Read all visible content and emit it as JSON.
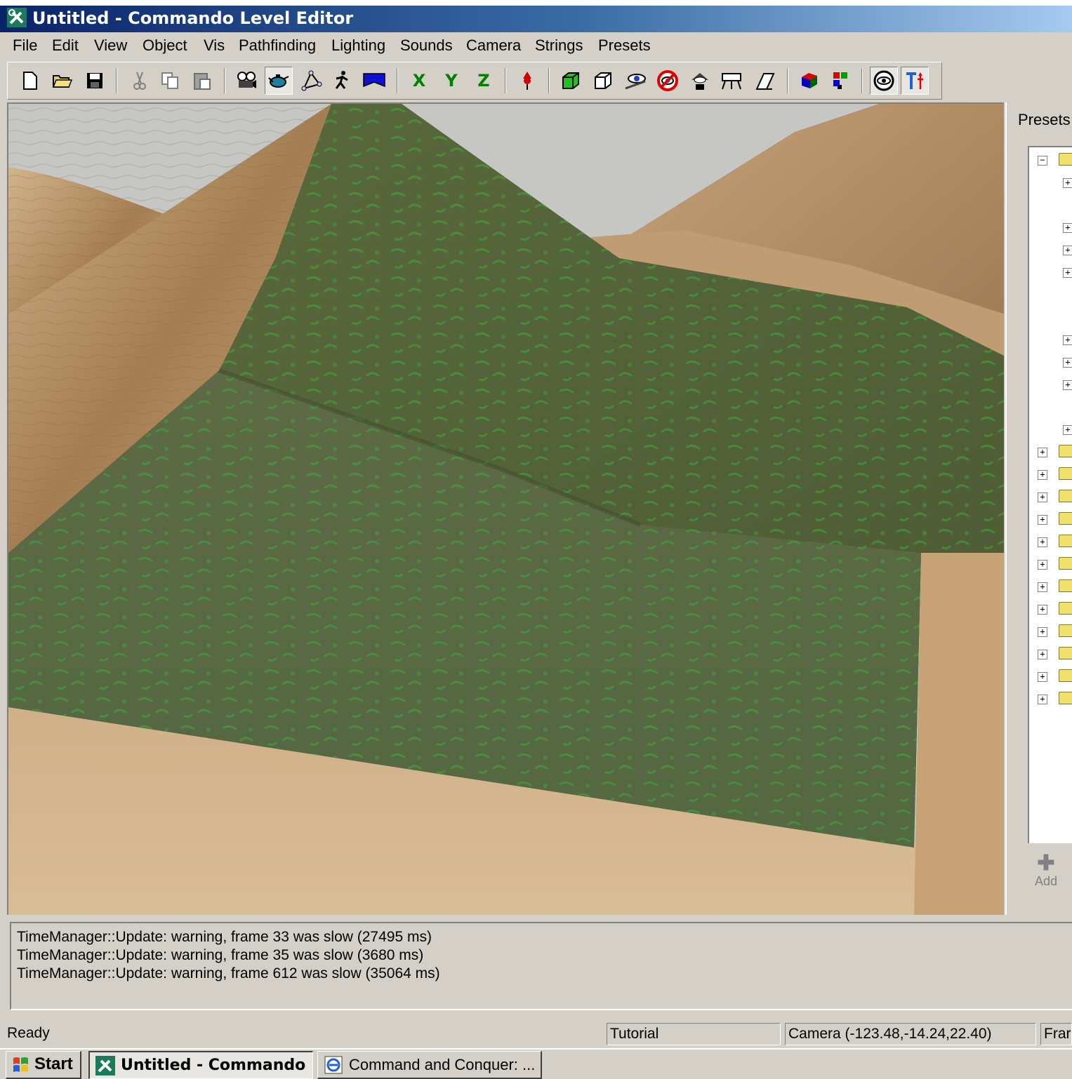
{
  "window": {
    "title": "Untitled - Commando Level Editor"
  },
  "menu": [
    "File",
    "Edit",
    "View",
    "Object",
    "Vis",
    "Pathfinding",
    "Lighting",
    "Sounds",
    "Camera",
    "Strings",
    "Presets"
  ],
  "toolbar": {
    "axis_x": "X",
    "axis_y": "Y",
    "axis_z": "Z",
    "icons": [
      "new-file-icon",
      "open-folder-icon",
      "save-icon",
      "cut-icon",
      "copy-icon",
      "paste-icon",
      "camera-mode-icon",
      "object-mode-icon",
      "gizmo-icon",
      "walk-icon",
      "flag-icon",
      "x-axis-icon",
      "y-axis-icon",
      "z-axis-icon",
      "pin-icon",
      "solid-box-icon",
      "wire-box-icon",
      "eye-icon",
      "hide-icon",
      "vis-icon",
      "backdrop-icon",
      "ruler-icon",
      "color-cube-icon",
      "palette-icon",
      "view-toggle-icon",
      "text-icon"
    ]
  },
  "presets": {
    "title": "Presets",
    "add_label": "Add"
  },
  "log": {
    "lines": [
      "TimeManager::Update: warning, frame 33 was slow (27495 ms)",
      "TimeManager::Update: warning, frame 35 was slow (3680 ms)",
      "TimeManager::Update: warning, frame 612 was slow (35064 ms)"
    ]
  },
  "status": {
    "ready": "Ready",
    "mode": "Tutorial",
    "camera": "Camera (-123.48,-14.24,22.40)",
    "frame": "Frar"
  },
  "taskbar": {
    "start": "Start",
    "tasks": [
      "Untitled - Commando ...",
      "Command and Conquer: ..."
    ]
  },
  "colors": {
    "titlebar_start": "#0a246a",
    "titlebar_end": "#a6caf0",
    "face": "#d4d0c8",
    "sand": "#c9a77e",
    "grass": "#4d6a3a",
    "sky": "#c8c8c8"
  }
}
